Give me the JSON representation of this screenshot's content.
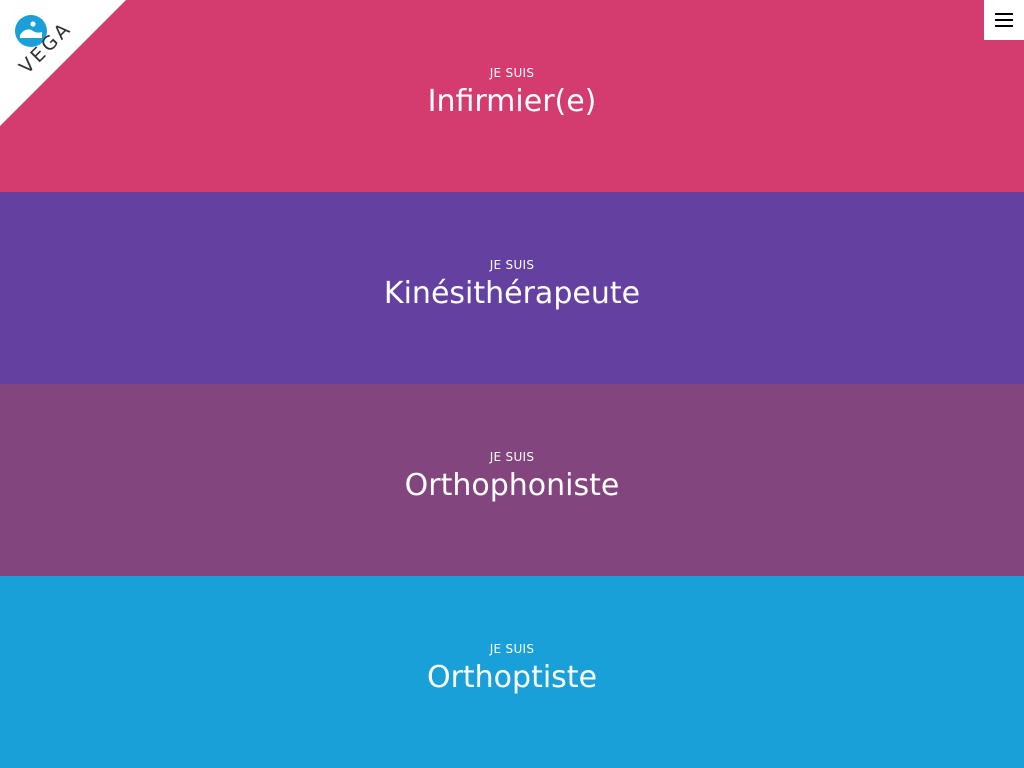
{
  "logo": {
    "text": "VEGA",
    "icon": "vega-logo-icon",
    "icon_color": "#1a9fd8"
  },
  "menu": {
    "icon": "hamburger-menu-icon"
  },
  "professions": [
    {
      "kicker": "JE SUIS",
      "label": "Infirmier(e)",
      "color": "#d43b6f"
    },
    {
      "kicker": "JE SUIS",
      "label": "Kinésithérapeute",
      "color": "#6441a0"
    },
    {
      "kicker": "JE SUIS",
      "label": "Orthophoniste",
      "color": "#83457d"
    },
    {
      "kicker": "JE SUIS",
      "label": "Orthoptiste",
      "color": "#19a0d8"
    }
  ]
}
